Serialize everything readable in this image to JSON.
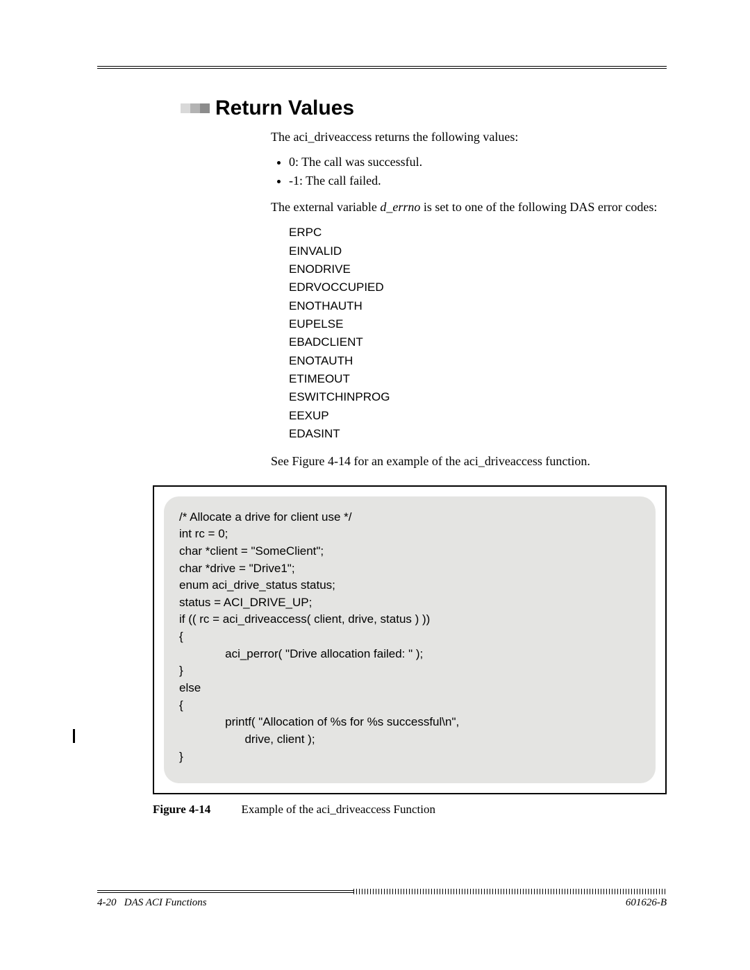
{
  "section": {
    "title": "Return Values"
  },
  "para1": "The aci_driveaccess returns the following values:",
  "bullets": [
    "0: The call was successful.",
    "-1: The call failed."
  ],
  "para2_a": "The external variable ",
  "para2_var": "d_errno",
  "para2_b": " is set to one of the following DAS error codes:",
  "error_codes": [
    "ERPC",
    "EINVALID",
    "ENODRIVE",
    "EDRVOCCUPIED",
    "ENOTHAUTH",
    "EUPELSE",
    "EBADCLIENT",
    "ENOTAUTH",
    "ETIMEOUT",
    "ESWITCHINPROG",
    "EEXUP",
    "EDASINT"
  ],
  "para3": "See Figure 4-14 for an example of the aci_driveaccess function.",
  "code": "/* Allocate a drive for client use */\nint rc = 0;\nchar *client = \"SomeClient\";\nchar *drive = \"Drive1\";\nenum aci_drive_status status;\nstatus = ACI_DRIVE_UP;\nif (( rc = aci_driveaccess( client, drive, status ) ))\n{\n              aci_perror( \"Drive allocation failed: \" );\n}\nelse\n{\n              printf( \"Allocation of %s for %s successful\\n\",\n                    drive, client );\n}",
  "figure": {
    "label": "Figure 4-14",
    "caption": "Example of the aci_driveaccess Function"
  },
  "footer": {
    "page": "4-20",
    "chapter": "DAS ACI Functions",
    "docnum": "601626-B"
  }
}
